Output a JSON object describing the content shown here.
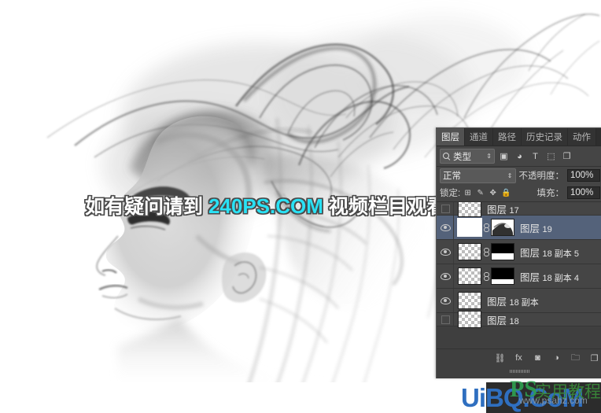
{
  "app": {
    "name": "Adobe Photoshop",
    "document_type": "image-editor"
  },
  "artwork": {
    "description": "Grayscale double-exposure of a woman's profile dissolving into smoke on white background",
    "background_color": "#ffffff",
    "ink_color": "#4a4a4a"
  },
  "watermark": {
    "prefix": "如有疑问请到 ",
    "brand": "240PS.COM",
    "suffix": " 视频栏目观看视频教程",
    "white_color": "#ffffff",
    "cyan_color": "#29e2f5",
    "outline_color": "#4a4a4a"
  },
  "footer_logo": {
    "site": "UiBQ.CoM",
    "site_color": "#2f6fc0",
    "ps_mark": "PS",
    "ps_color": "#2f9e4f",
    "cn_mark": "实用教程",
    "url_mark": "www.psahz.com"
  },
  "layers_panel": {
    "tabs": [
      {
        "label": "图层",
        "active": true
      },
      {
        "label": "通道",
        "active": false
      },
      {
        "label": "路径",
        "active": false
      },
      {
        "label": "历史记录",
        "active": false
      },
      {
        "label": "动作",
        "active": false
      }
    ],
    "filter_row": {
      "search_icon": "search-icon",
      "kind_label": "类型",
      "stepper": "⇕",
      "filter_buttons": [
        {
          "name": "filter-pixel-icon",
          "glyph": "▣"
        },
        {
          "name": "filter-adjustment-icon",
          "glyph": "◕"
        },
        {
          "name": "filter-type-icon",
          "glyph": "T"
        },
        {
          "name": "filter-shape-icon",
          "glyph": "⬚"
        },
        {
          "name": "filter-smart-object-icon",
          "glyph": "❐"
        }
      ]
    },
    "blend_row": {
      "mode": "正常",
      "stepper": "⇕",
      "opacity_label": "不透明度：",
      "opacity_value": "100%"
    },
    "lock_row": {
      "lock_label": "锁定:",
      "lock_icons": [
        "lock-transparency-icon",
        "lock-pixels-icon",
        "lock-position-icon",
        "lock-all-icon"
      ],
      "lock_glyphs": [
        "⊞",
        "✎",
        "✥",
        "🔒"
      ],
      "fill_label": "填充：",
      "fill_value": "100%"
    },
    "layers": [
      {
        "name_cn": "图层",
        "number": "17",
        "visible": false,
        "selected": false,
        "thumb": "checker",
        "has_mask": false,
        "partial": true
      },
      {
        "name_cn": "图层",
        "number": "19",
        "visible": true,
        "selected": true,
        "thumb": "white",
        "has_mask": true,
        "mask_style": "smoke",
        "partial": false
      },
      {
        "name_cn": "图层",
        "number": "18 副本 5",
        "visible": true,
        "selected": false,
        "thumb": "checker",
        "has_mask": true,
        "mask_style": "blackband",
        "partial": false
      },
      {
        "name_cn": "图层",
        "number": "18 副本 4",
        "visible": true,
        "selected": false,
        "thumb": "checker",
        "has_mask": true,
        "mask_style": "blackband2",
        "partial": false
      },
      {
        "name_cn": "图层",
        "number": "18 副本",
        "visible": true,
        "selected": false,
        "thumb": "checker",
        "has_mask": false,
        "partial": false
      },
      {
        "name_cn": "图层",
        "number": "18",
        "visible": false,
        "selected": false,
        "thumb": "checker",
        "has_mask": false,
        "partial": true
      }
    ],
    "footer_buttons": [
      {
        "name": "link-layers-button",
        "glyph": "⛓"
      },
      {
        "name": "layer-style-button",
        "glyph": "fx"
      },
      {
        "name": "add-layer-mask-button",
        "glyph": "◙"
      },
      {
        "name": "new-adjustment-layer-button",
        "glyph": "◑"
      },
      {
        "name": "new-group-button",
        "glyph": "🗀"
      },
      {
        "name": "new-layer-button",
        "glyph": "❐"
      }
    ],
    "panel_bg": "#3f3f3f",
    "selected_row_color": "#54627a"
  }
}
